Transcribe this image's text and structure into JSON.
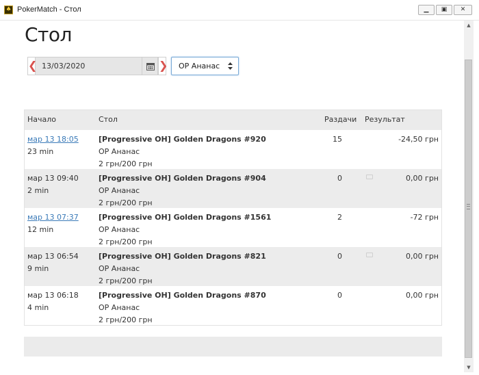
{
  "window": {
    "title": "PokerMatch - Стол"
  },
  "page": {
    "title": "Стол"
  },
  "filter": {
    "date": "13/03/2020",
    "prev_symbol": "❮",
    "next_symbol": "❯",
    "table_selected": "OP Ананас"
  },
  "table": {
    "headers": {
      "start": "Начало",
      "table": "Стол",
      "hands": "Раздачи",
      "result": "Результат"
    },
    "rows": [
      {
        "start": "мар 13 18:05",
        "duration": "23 min",
        "name": "[Progressive OH] Golden Dragons #920",
        "player": "OP Ананас",
        "stakes": "2 грн/200 грн",
        "hands": "15",
        "result": "-24,50 грн",
        "link": true,
        "note": false
      },
      {
        "start": "мар 13 09:40",
        "duration": "2 min",
        "name": "[Progressive OH] Golden Dragons #904",
        "player": "OP Ананас",
        "stakes": "2 грн/200 грн",
        "hands": "0",
        "result": "0,00 грн",
        "link": false,
        "note": true
      },
      {
        "start": "мар 13 07:37",
        "duration": "12 min",
        "name": "[Progressive OH] Golden Dragons #1561",
        "player": "OP Ананас",
        "stakes": "2 грн/200 грн",
        "hands": "2",
        "result": "-72 грн",
        "link": true,
        "note": false
      },
      {
        "start": "мар 13 06:54",
        "duration": "9 min",
        "name": "[Progressive OH] Golden Dragons #821",
        "player": "OP Ананас",
        "stakes": "2 грн/200 грн",
        "hands": "0",
        "result": "0,00 грн",
        "link": false,
        "note": true
      },
      {
        "start": "мар 13 06:18",
        "duration": "4 min",
        "name": "[Progressive OH] Golden Dragons #870",
        "player": "OP Ананас",
        "stakes": "2 грн/200 грн",
        "hands": "0",
        "result": "0,00 грн",
        "link": false,
        "note": false
      }
    ]
  },
  "icons": {
    "calendar": "calendar-icon",
    "caret": "select-caret-icon",
    "app": "app-icon"
  },
  "colors": {
    "accent_red": "#d9534f",
    "link_blue": "#3a7ab8",
    "row_alt": "#ececec",
    "focus_border": "#7aaad6"
  }
}
